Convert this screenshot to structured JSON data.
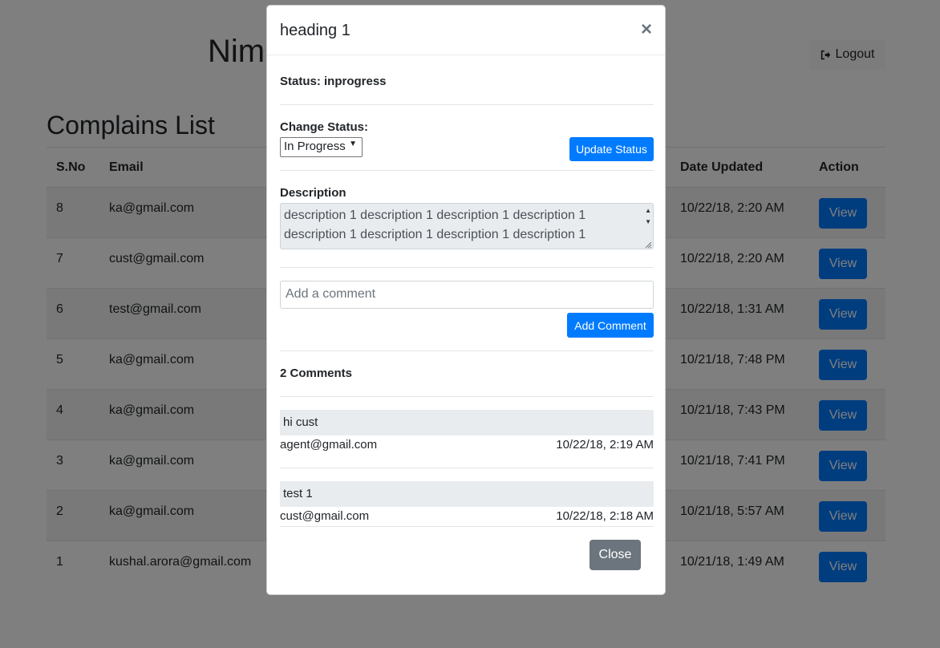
{
  "page": {
    "brand_title": "Nim",
    "logout_label": "Logout",
    "list_title": "Complains List",
    "columns": {
      "sno": "S.No",
      "email": "Email",
      "date_updated": "Date Updated",
      "action": "Action"
    },
    "rows": [
      {
        "sno": "8",
        "email": "ka@gmail.com",
        "date": "10/22/18, 2:20 AM",
        "action": "View"
      },
      {
        "sno": "7",
        "email": "cust@gmail.com",
        "date": "10/22/18, 2:20 AM",
        "action": "View"
      },
      {
        "sno": "6",
        "email": "test@gmail.com",
        "date": "10/22/18, 1:31 AM",
        "action": "View"
      },
      {
        "sno": "5",
        "email": "ka@gmail.com",
        "date": "10/21/18, 7:48 PM",
        "action": "View"
      },
      {
        "sno": "4",
        "email": "ka@gmail.com",
        "date": "10/21/18, 7:43 PM",
        "action": "View"
      },
      {
        "sno": "3",
        "email": "ka@gmail.com",
        "date": "10/21/18, 7:41 PM",
        "action": "View"
      },
      {
        "sno": "2",
        "email": "ka@gmail.com",
        "date": "10/21/18, 5:57 AM",
        "action": "View"
      },
      {
        "sno": "1",
        "email": "kushal.arora@gmail.com",
        "date": "10/21/18, 1:49 AM",
        "action": "View"
      }
    ]
  },
  "modal": {
    "title": "heading 1",
    "close_icon": "×",
    "status_text": "Status: inprogress",
    "change_status_label": "Change Status:",
    "status_select_value": "In Progress",
    "update_status_label": "Update Status",
    "description_label": "Description",
    "description_lines": [
      "description 1 description 1 description 1 description 1",
      "description 1 description 1 description 1 description 1"
    ],
    "comment_placeholder": "Add a comment",
    "add_comment_label": "Add Comment",
    "comments_title": "2 Comments",
    "comments": [
      {
        "text": "hi cust",
        "author": "agent@gmail.com",
        "date": "10/22/18, 2:19 AM"
      },
      {
        "text": "test 1",
        "author": "cust@gmail.com",
        "date": "10/22/18, 2:18 AM"
      }
    ],
    "close_label": "Close"
  },
  "colors": {
    "primary": "#007bff",
    "secondary": "#6c757d",
    "backdrop": "rgba(0,0,0,0.5)"
  },
  "icons": {
    "logout": "sign-out-icon",
    "close": "close-icon"
  }
}
